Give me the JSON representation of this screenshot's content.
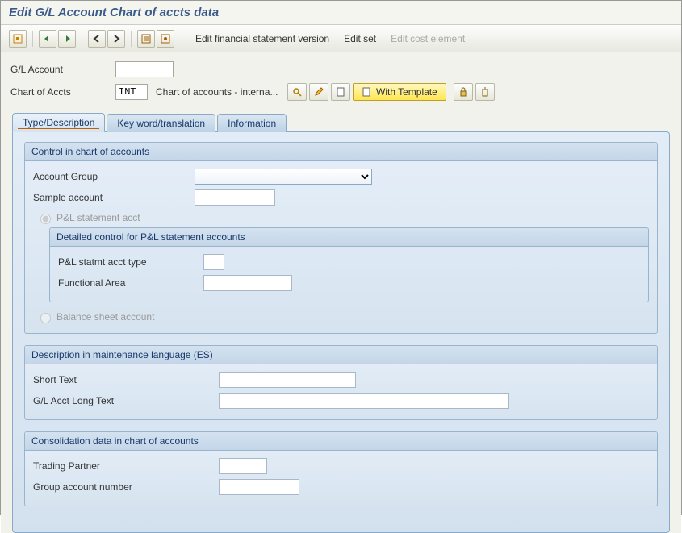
{
  "title": "Edit G/L Account Chart of accts data",
  "toolbar": {
    "edit_fin_stmt": "Edit financial statement version",
    "edit_set": "Edit set",
    "edit_cost_element": "Edit cost element"
  },
  "header": {
    "gl_account_label": "G/L Account",
    "gl_account_value": "",
    "chart_of_accts_label": "Chart of Accts",
    "chart_of_accts_value": "INT",
    "chart_of_accts_desc": "Chart of accounts - interna...",
    "with_template_label": "With Template"
  },
  "tabs": {
    "type_desc": "Type/Description",
    "keyword": "Key word/translation",
    "information": "Information"
  },
  "group_control": {
    "title": "Control in chart of accounts",
    "account_group_label": "Account Group",
    "sample_account_label": "Sample account",
    "radio_pl": "P&L statement acct",
    "sub_title": "Detailed control for P&L statement accounts",
    "pl_type_label": "P&L statmt acct type",
    "func_area_label": "Functional Area",
    "radio_balance": "Balance sheet account"
  },
  "group_desc": {
    "title": "Description in maintenance language (ES)",
    "short_text_label": "Short Text",
    "long_text_label": "G/L Acct Long Text"
  },
  "group_consol": {
    "title": "Consolidation data in chart of accounts",
    "trading_partner_label": "Trading Partner",
    "group_account_label": "Group account number"
  }
}
